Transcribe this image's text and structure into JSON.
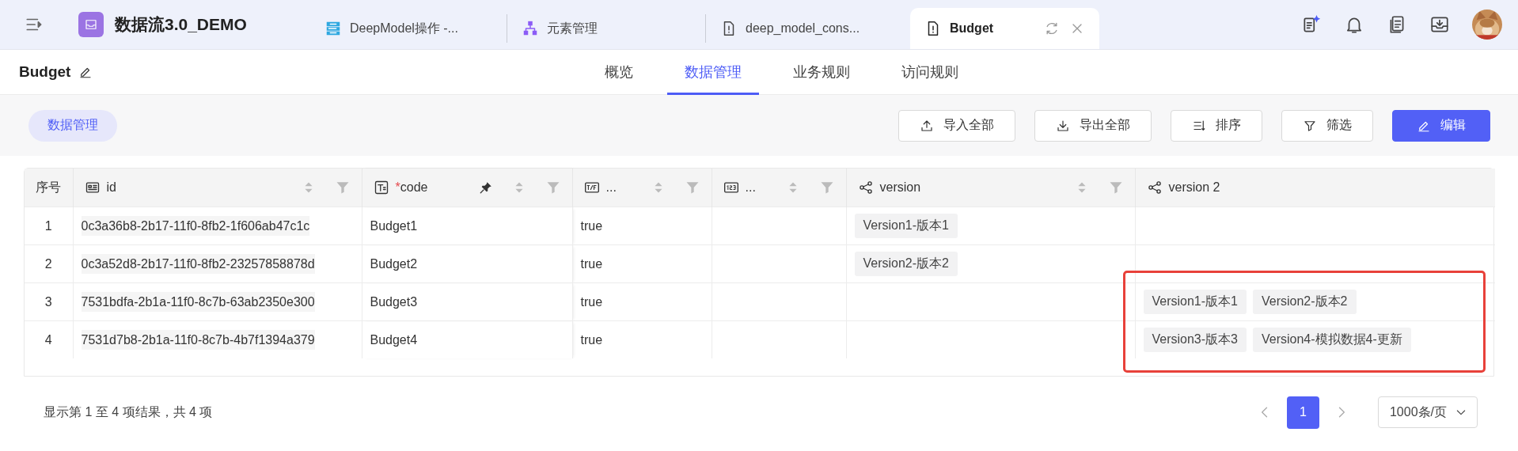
{
  "app": {
    "title": "数据流3.0_DEMO"
  },
  "tabs": [
    {
      "label": "DeepModel操作 -...",
      "kind": "diagram",
      "selected": false
    },
    {
      "label": "元素管理",
      "kind": "hierarchy",
      "selected": false
    },
    {
      "label": "deep_model_cons...",
      "kind": "document",
      "selected": false
    },
    {
      "label": "Budget",
      "kind": "document",
      "selected": true
    }
  ],
  "page": {
    "title": "Budget"
  },
  "nav": [
    {
      "label": "概览",
      "selected": false
    },
    {
      "label": "数据管理",
      "selected": true
    },
    {
      "label": "业务规则",
      "selected": false
    },
    {
      "label": "访问规则",
      "selected": false
    }
  ],
  "toolbar": {
    "chip": "数据管理",
    "buttons": [
      {
        "label": "导入全部",
        "kind": "outline"
      },
      {
        "label": "导出全部",
        "kind": "outline"
      },
      {
        "label": "排序",
        "kind": "outline"
      },
      {
        "label": "筛选",
        "kind": "outline"
      },
      {
        "label": "编辑",
        "kind": "primary"
      }
    ]
  },
  "table": {
    "columns": [
      {
        "label": "序号",
        "kind": "sequence",
        "sortable": false,
        "filterable": false,
        "pinned": false
      },
      {
        "label": "id",
        "kind": "id",
        "sortable": true,
        "filterable": true,
        "pinned": false
      },
      {
        "label": "code",
        "required_mark": "*",
        "kind": "text",
        "sortable": true,
        "filterable": true,
        "pinned": true
      },
      {
        "label": "...",
        "kind": "boolean",
        "sortable": true,
        "filterable": true,
        "pinned": false
      },
      {
        "label": "...",
        "kind": "number",
        "sortable": true,
        "filterable": true,
        "pinned": false
      },
      {
        "label": "version",
        "kind": "relation",
        "sortable": true,
        "filterable": true,
        "pinned": false
      },
      {
        "label": "version  2",
        "kind": "relation",
        "sortable": false,
        "filterable": false,
        "pinned": false
      }
    ],
    "rows": [
      {
        "index": "1",
        "id": "0c3a36b8-2b17-11f0-8fb2-1f606ab47c1c",
        "code": "Budget1",
        "column_4": "true",
        "version": [
          "Version1-版本1"
        ],
        "version_2": []
      },
      {
        "index": "2",
        "id": "0c3a52d8-2b17-11f0-8fb2-23257858878d",
        "code": "Budget2",
        "column_4": "true",
        "version": [
          "Version2-版本2"
        ],
        "version_2": []
      },
      {
        "index": "3",
        "id": "7531bdfa-2b1a-11f0-8c7b-63ab2350e300",
        "code": "Budget3",
        "column_4": "true",
        "version": [],
        "version_2": [
          "Version1-版本1",
          "Version2-版本2"
        ]
      },
      {
        "index": "4",
        "id": "7531d7b8-2b1a-11f0-8c7b-4b7f1394a379",
        "code": "Budget4",
        "column_4": "true",
        "version": [],
        "version_2": [
          "Version3-版本3",
          "Version4-模拟数据4-更新"
        ]
      }
    ]
  },
  "footer": {
    "summary": "显示第 1 至 4 项结果，共 4 项",
    "pages": [
      {
        "label": "1",
        "selected": true
      }
    ],
    "page_size": "1000条/页"
  }
}
